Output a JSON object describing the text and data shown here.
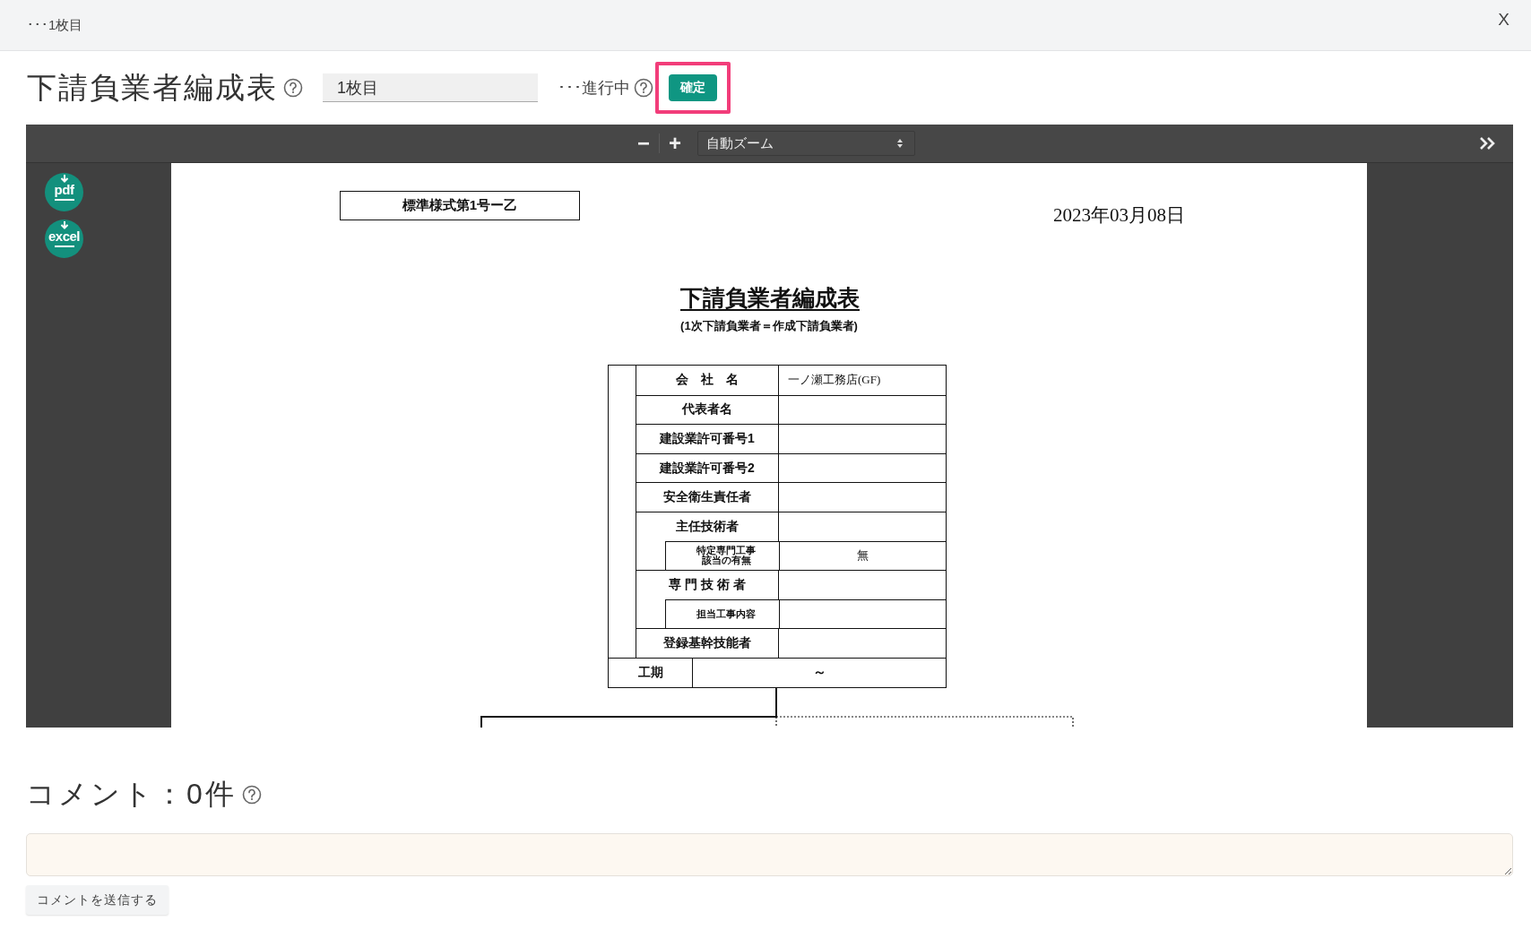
{
  "top_bar": {
    "title": "･･･1枚目",
    "close": "X"
  },
  "header": {
    "title": "下請負業者編成表",
    "sheet_field": {
      "value": "1枚目"
    },
    "status": "･･･進行中",
    "confirm_button": "確定",
    "confirm_highlighted": true
  },
  "viewer": {
    "toolbar": {
      "zoom_out": "−",
      "zoom_in": "+",
      "zoom_select": "自動ズーム"
    },
    "downloads": [
      {
        "label": "pdf"
      },
      {
        "label": "excel"
      }
    ],
    "document": {
      "form_number": "標準様式第1号ー乙",
      "date": "2023年03月08日",
      "title": "下請負業者編成表",
      "subtitle": "(1次下請負業者＝作成下請負業者)",
      "rows": [
        {
          "kind": "main",
          "label": "会　社　名",
          "value": "一ノ瀬工務店(GF)"
        },
        {
          "kind": "main",
          "label": "代表者名"
        },
        {
          "kind": "main",
          "label": "建設業許可番号1"
        },
        {
          "kind": "main",
          "label": "建設業許可番号2"
        },
        {
          "kind": "main",
          "label": "安全衛生責任者"
        },
        {
          "kind": "main",
          "label": "主任技術者"
        },
        {
          "kind": "sub",
          "label": "特定専門工事該当の有無",
          "value": "無"
        },
        {
          "kind": "main",
          "label": "専 門 技 術 者"
        },
        {
          "kind": "sub",
          "label": "担当工事内容"
        },
        {
          "kind": "main",
          "label": "登録基幹技能者"
        }
      ],
      "period": {
        "label": "工期",
        "value": "～"
      }
    }
  },
  "comments": {
    "heading": "コメント：0件",
    "send_button": "コメントを送信する"
  }
}
